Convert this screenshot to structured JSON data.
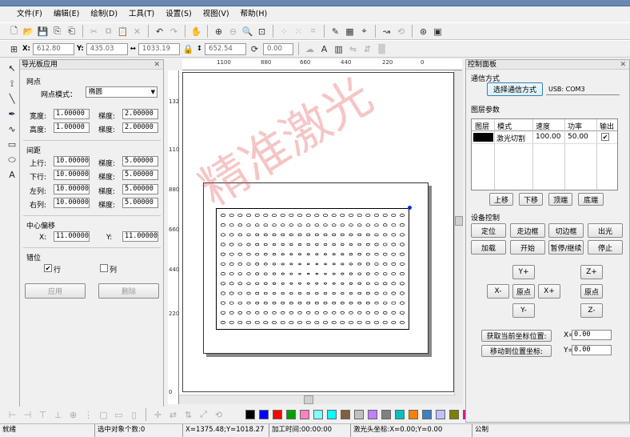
{
  "window": {
    "title": "就绪"
  },
  "menu": [
    "文件(F)",
    "编辑(E)",
    "绘制(D)",
    "工具(T)",
    "设置(S)",
    "视图(V)",
    "帮助(H)"
  ],
  "coords": {
    "x": "612.80",
    "y": "435.03",
    "w": "1033.19",
    "h": "652.54",
    "angle": "0.00"
  },
  "left_panel": {
    "title": "导光板应用",
    "dots_group": "网点",
    "mode_label": "网点模式：",
    "mode_value": "椭圆",
    "width_label": "宽度:",
    "width_value": "1.00000",
    "height_label": "高度:",
    "height_value": "1.00000",
    "grad1_label": "梯度:",
    "grad1_value": "2.00000",
    "grad2_label": "梯度:",
    "grad2_value": "2.00000",
    "spacing_group": "间距",
    "rows": [
      {
        "label": "上行:",
        "value": "10.00000",
        "glabel": "梯度:",
        "gvalue": "5.00000"
      },
      {
        "label": "下行:",
        "value": "10.00000",
        "glabel": "梯度:",
        "gvalue": "5.00000"
      },
      {
        "label": "左列:",
        "value": "10.00000",
        "glabel": "梯度:",
        "gvalue": "5.00000"
      },
      {
        "label": "右列:",
        "value": "10.00000",
        "glabel": "梯度:",
        "gvalue": "5.00000"
      }
    ],
    "offset_group": "中心偏移",
    "offset_x_label": "X:",
    "offset_x": "11.00000",
    "offset_y_label": "Y:",
    "offset_y": "11.00000",
    "stagger_group": "错位",
    "row_label": "行",
    "col_label": "列",
    "apply": "应用",
    "delete": "删除"
  },
  "ruler_h": [
    "1100",
    "880",
    "660",
    "440",
    "220",
    "0"
  ],
  "ruler_v": [
    "1320",
    "1100",
    "880",
    "660",
    "440",
    "220",
    "0"
  ],
  "watermark": "精准激光",
  "control_panel": {
    "title": "控制面板",
    "comm_group": "通信方式",
    "comm_button": "选择通信方式",
    "comm_value": "USB: COM3",
    "layer_group": "图层参数",
    "headers": [
      "图层",
      "模式",
      "速度",
      "功率",
      "输出"
    ],
    "layer_row": {
      "mode": "激光切割",
      "speed": "100.00",
      "power": "50.00",
      "output": "✔",
      "color": "#000000"
    },
    "layer_buttons": [
      "上移",
      "下移",
      "顶端",
      "底端"
    ],
    "device_group": "设备控制",
    "device_buttons": [
      "定位",
      "走边框",
      "切边框",
      "出光",
      "加载",
      "开始",
      "暂停/继续",
      "停止"
    ],
    "jog": {
      "yp": "Y+",
      "xm": "X-",
      "origin": "原点",
      "xp": "X+",
      "ym": "Y-",
      "zp": "Z+",
      "zorigin": "原点",
      "zm": "Z-"
    },
    "get_pos": "获取当前坐标位置:",
    "move_pos": "移动到位置坐标:",
    "x_label": "X=",
    "x_value": "0.00",
    "y_label": "Y=",
    "y_value": "0.00"
  },
  "palette": [
    "#000000",
    "#0000ff",
    "#ff0000",
    "#00a000",
    "#ff80c0",
    "#80ffff",
    "#00ffff",
    "#806040",
    "#c0c0c0",
    "#c080ff",
    "#808080",
    "#00c0c0",
    "#ff8000",
    "#4080c0",
    "#c0c0ff",
    "#808000",
    "#ff0080",
    "#008080",
    "#80ff00"
  ],
  "status": {
    "ready": "就绪",
    "selected": "选中对象个数:0",
    "cursor": "X=1375.48;Y=1018.27",
    "time": "加工时间:00:00:00",
    "laser": "激光头坐标:X=0.00;Y=0.00",
    "unit": "公制"
  }
}
